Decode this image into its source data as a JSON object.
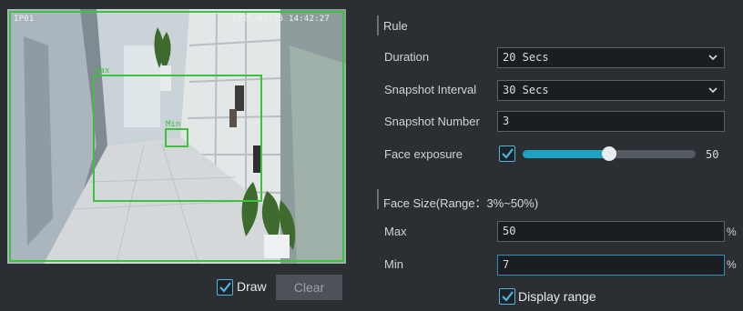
{
  "preview": {
    "channel": "IP01",
    "timestamp": "2020/03/25 14:42:27",
    "max_label": "Max",
    "min_label": "Min"
  },
  "controls": {
    "draw_label": "Draw",
    "draw_checked": true,
    "clear_label": "Clear"
  },
  "rule": {
    "section_title": "Rule",
    "duration_label": "Duration",
    "duration_value": "20 Secs",
    "snapshot_interval_label": "Snapshot Interval",
    "snapshot_interval_value": "30 Secs",
    "snapshot_number_label": "Snapshot Number",
    "snapshot_number_value": "3",
    "face_exposure_label": "Face exposure",
    "face_exposure_checked": true,
    "face_exposure_value": "50",
    "face_exposure_fraction": 0.5
  },
  "face_size": {
    "section_title": "Face Size(Range：3%~50%)",
    "max_label": "Max",
    "max_value": "50",
    "min_label": "Min",
    "min_value": "7",
    "unit": "%",
    "display_range_label": "Display range",
    "display_range_checked": true
  },
  "colors": {
    "accent": "#1da3bf",
    "detection_box": "#3ec13e",
    "background": "#2b2f34"
  }
}
